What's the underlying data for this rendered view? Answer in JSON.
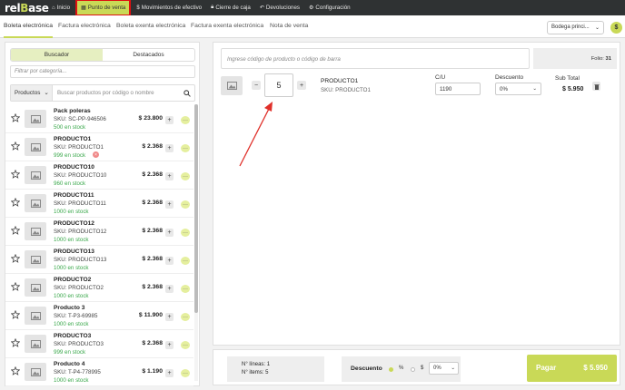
{
  "brand": {
    "logo_main": "rel",
    "logo_accent": "B",
    "logo_rest": "ase",
    "accent_color": "#c9d957"
  },
  "nav": [
    {
      "label": "Inicio",
      "icon": "home-icon"
    },
    {
      "label": "Punto de venta",
      "icon": "register-icon"
    },
    {
      "label": "Movimientos de efectivo",
      "icon": "dollar-icon"
    },
    {
      "label": "Cierre de caja",
      "icon": "lock-icon"
    },
    {
      "label": "Devoluciones",
      "icon": "return-icon"
    },
    {
      "label": "Configuración",
      "icon": "gear-icon"
    }
  ],
  "doc_tabs": [
    "Boleta electrónica",
    "Factura electrónica",
    "Boleta exenta electrónica",
    "Factura exenta electrónica",
    "Nota de venta"
  ],
  "bodega": {
    "selected": "Bodega princi..."
  },
  "dollar_button": "$",
  "left": {
    "segments": [
      "Buscador",
      "Destacados"
    ],
    "filter_placeholder": "Filtrar por categoría...",
    "product_select": "Productos",
    "search_placeholder": "Buscar productos por código o nombre",
    "products": [
      {
        "name": "Pack poleras",
        "sku": "SKU: SC-PP-946506",
        "stock": "500 en stock",
        "price": "$ 23.800"
      },
      {
        "name": "PRODUCTO1",
        "sku": "SKU: PRODUCTO1",
        "stock": "999 en stock",
        "price": "$ 2.368",
        "badge": "×"
      },
      {
        "name": "PRODUCTO10",
        "sku": "SKU: PRODUCTO10",
        "stock": "960 en stock",
        "price": "$ 2.368"
      },
      {
        "name": "PRODUCTO11",
        "sku": "SKU: PRODUCTO11",
        "stock": "1000 en stock",
        "price": "$ 2.368"
      },
      {
        "name": "PRODUCTO12",
        "sku": "SKU: PRODUCTO12",
        "stock": "1000 en stock",
        "price": "$ 2.368"
      },
      {
        "name": "PRODUCTO13",
        "sku": "SKU: PRODUCTO13",
        "stock": "1000 en stock",
        "price": "$ 2.368"
      },
      {
        "name": "PRODUCTO2",
        "sku": "SKU: PRODUCTO2",
        "stock": "1000 en stock",
        "price": "$ 2.368"
      },
      {
        "name": "Producto 3",
        "sku": "SKU: T-P3-69985",
        "stock": "1000 en stock",
        "price": "$ 11.900"
      },
      {
        "name": "PRODUCTO3",
        "sku": "SKU: PRODUCTO3",
        "stock": "999 en stock",
        "price": "$ 2.368"
      },
      {
        "name": "Producto 4",
        "sku": "SKU: T-P4-778995",
        "stock": "1000 en stock",
        "price": "$ 1.190"
      }
    ],
    "plus_label": "+",
    "more_label": "···"
  },
  "right": {
    "barcode_placeholder": "Ingrese código de producto o código de barra",
    "folio_label": "Folio:",
    "folio_value": "31",
    "line": {
      "minus": "−",
      "qty": "5",
      "plus": "+",
      "name": "PRODUCTO1",
      "sku": "SKU: PRODUCTO1",
      "cu_label": "C/U",
      "cu_value": "1190",
      "desc_label": "Descuento",
      "desc_value": "0%",
      "sub_label": "Sub Total",
      "sub_value": "$ 5.950"
    }
  },
  "bottom": {
    "lines": "N° líneas: 1",
    "items": "N° items: 5",
    "desc_title": "Descuento",
    "pct": "%",
    "dol": "$",
    "desc_select": "0%",
    "pay_label": "Pagar",
    "pay_total": "$ 5.950"
  }
}
